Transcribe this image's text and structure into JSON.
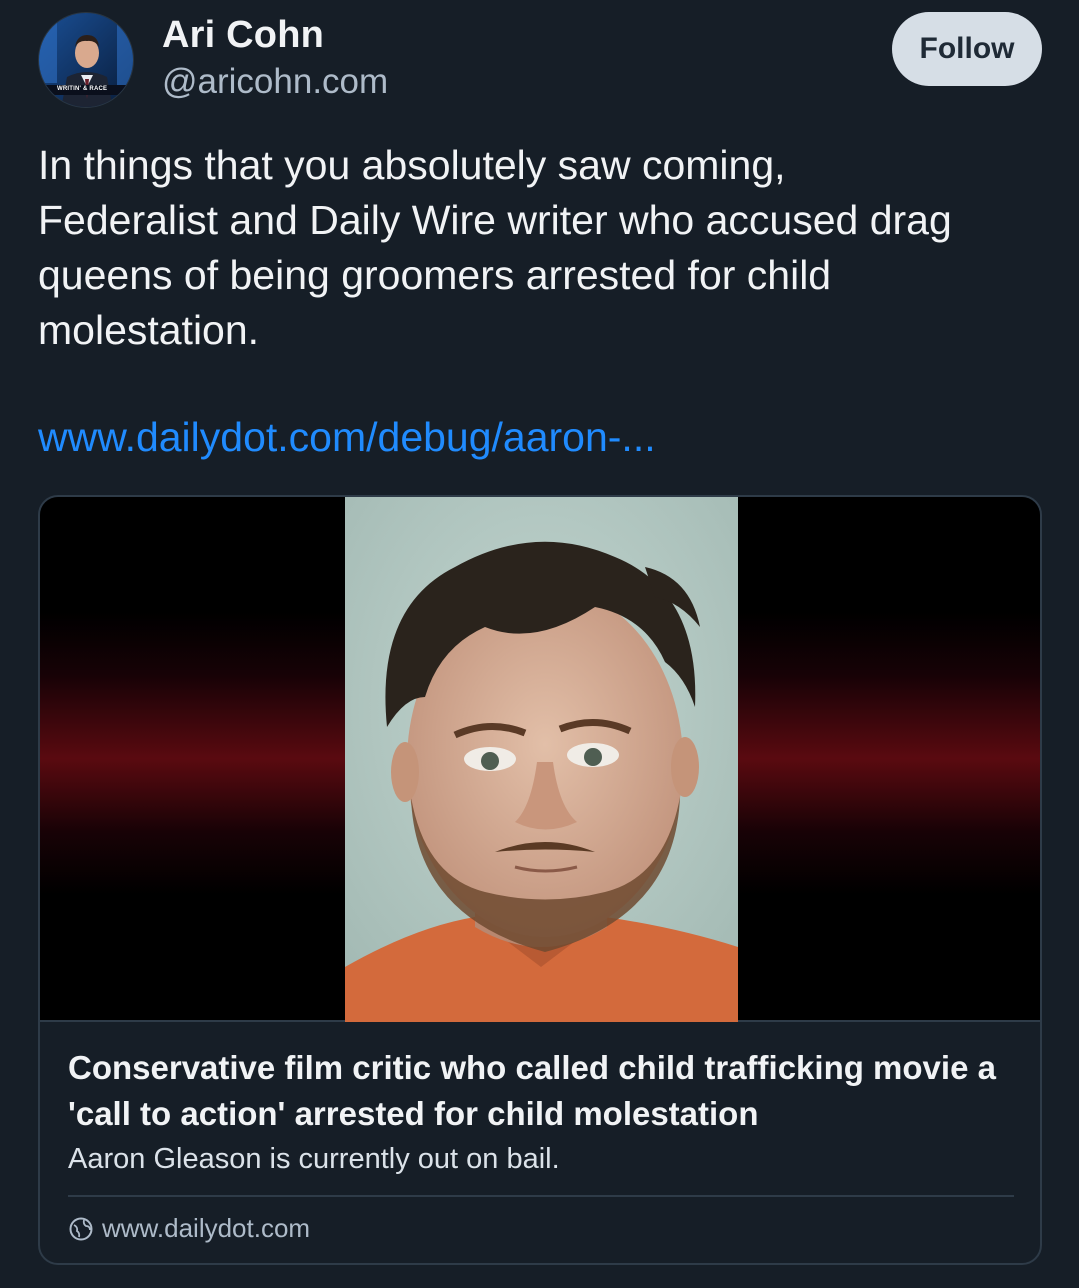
{
  "author": {
    "name": "Ari Cohn",
    "handle": "@aricohn.com",
    "avatar_banner_text": "WRITIN' & RACE"
  },
  "follow_button": {
    "label": "Follow"
  },
  "post": {
    "text": "In things that you absolutely saw coming,\nFederalist and Daily Wire writer who accused drag\nqueens of being groomers arrested for child\nmolestation.",
    "link_text": "www.dailydot.com/debug/aaron-..."
  },
  "link_card": {
    "title": "Conservative film critic who called child trafficking movie a 'call to action' arrested for child molestation",
    "description": "Aaron Gleason is currently out on bail.",
    "domain": "www.dailydot.com"
  },
  "colors": {
    "background": "#161e27",
    "link": "#208bfe",
    "follow_bg": "#d6dee6",
    "muted_text": "#aebbc9"
  },
  "icons": [
    "globe-icon"
  ]
}
